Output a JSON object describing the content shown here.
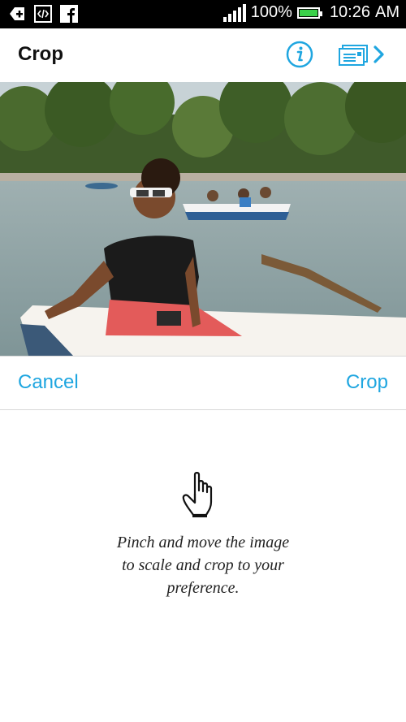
{
  "status_bar": {
    "battery_percent": "100%",
    "time": "10:26",
    "ampm": "AM",
    "battery_level": 1.0,
    "icons": [
      "add-icon",
      "code-icon",
      "facebook-icon",
      "signal-icon",
      "battery-icon"
    ]
  },
  "header": {
    "title": "Crop",
    "info_icon": "info-icon",
    "next_icon": "postcard-next-icon"
  },
  "actions": {
    "cancel_label": "Cancel",
    "crop_label": "Crop"
  },
  "instructions": {
    "text": "Pinch and move the image\nto scale and crop to your\npreference.",
    "icon": "hand-pointer-icon"
  },
  "colors": {
    "accent": "#1fa6e0",
    "status_bar": "#000000",
    "battery": "#3bd14a"
  }
}
